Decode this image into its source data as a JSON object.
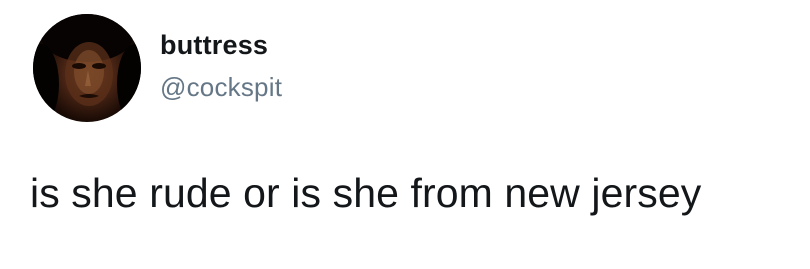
{
  "tweet": {
    "author": {
      "display_name": "buttress",
      "handle": "@cockspit",
      "avatar_icon": "profile-photo-dark-face"
    },
    "text": "is she rude or is she from new jersey"
  },
  "colors": {
    "name": "#14171a",
    "handle": "#657786",
    "background": "#ffffff"
  }
}
